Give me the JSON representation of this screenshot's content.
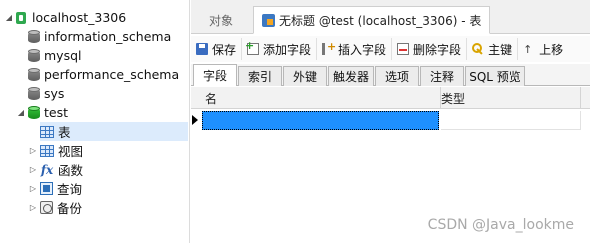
{
  "nav": {
    "connection": "localhost_3306",
    "databases": [
      {
        "name": "information_schema"
      },
      {
        "name": "mysql"
      },
      {
        "name": "performance_schema"
      },
      {
        "name": "sys"
      },
      {
        "name": "test"
      }
    ],
    "test_children": [
      {
        "label": "表",
        "icon": "table-icon"
      },
      {
        "label": "视图",
        "icon": "view-icon"
      },
      {
        "label": "函数",
        "icon": "function-icon"
      },
      {
        "label": "查询",
        "icon": "query-icon"
      },
      {
        "label": "备份",
        "icon": "backup-icon"
      }
    ]
  },
  "doc_tabs": {
    "objects": "对象",
    "active": "无标题 @test (localhost_3306) - 表"
  },
  "toolbar": {
    "save": "保存",
    "add_field": "添加字段",
    "insert_field": "插入字段",
    "delete_field": "删除字段",
    "primary_key": "主键",
    "move_up": "上移"
  },
  "sub_tabs": [
    "字段",
    "索引",
    "外键",
    "触发器",
    "选项",
    "注释",
    "SQL 预览"
  ],
  "grid": {
    "columns": [
      "名",
      "类型"
    ]
  },
  "watermark": "CSDN @Java_lookme",
  "colors": {
    "selection": "#1e90ff",
    "accent_green": "#2fa84f"
  }
}
